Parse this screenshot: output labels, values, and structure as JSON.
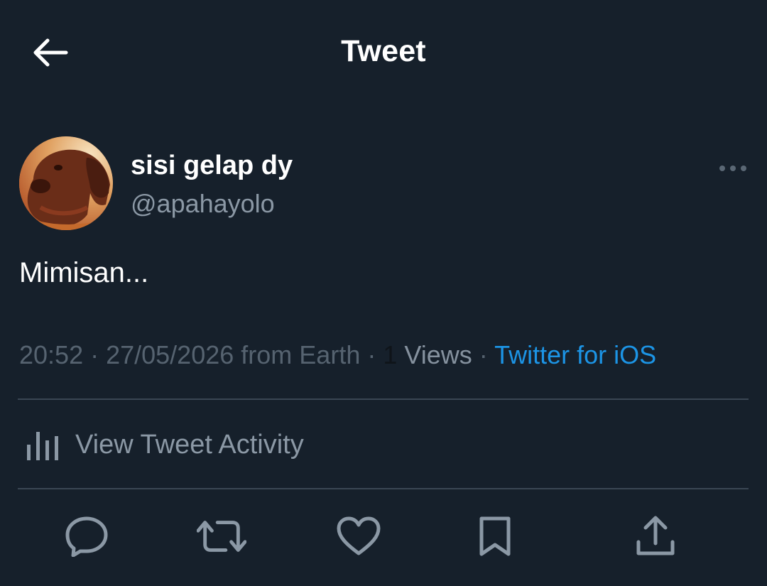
{
  "header": {
    "title": "Tweet",
    "back_icon": "arrow-left-icon"
  },
  "author": {
    "display_name": "sisi gelap dy",
    "handle": "@apahayolo",
    "avatar": "dog-avatar",
    "more_icon": "more-horizontal-icon"
  },
  "tweet": {
    "text": "Mimisan..."
  },
  "meta": {
    "time": "20:52",
    "date": "27/05/2026",
    "location": "from Earth",
    "views_count": "1",
    "views_label": "Views",
    "source": "Twitter for iOS"
  },
  "activity": {
    "label": "View Tweet Activity",
    "icon": "bar-chart-icon"
  },
  "actions": [
    {
      "name": "reply",
      "icon": "reply-icon"
    },
    {
      "name": "retweet",
      "icon": "retweet-icon"
    },
    {
      "name": "like",
      "icon": "heart-icon"
    },
    {
      "name": "bookmark",
      "icon": "bookmark-icon"
    },
    {
      "name": "share",
      "icon": "share-icon"
    }
  ],
  "colors": {
    "background": "#16202b",
    "text": "#ffffff",
    "secondary": "#8b98a5",
    "accent": "#1d9bf0",
    "divider": "#3a4653"
  }
}
